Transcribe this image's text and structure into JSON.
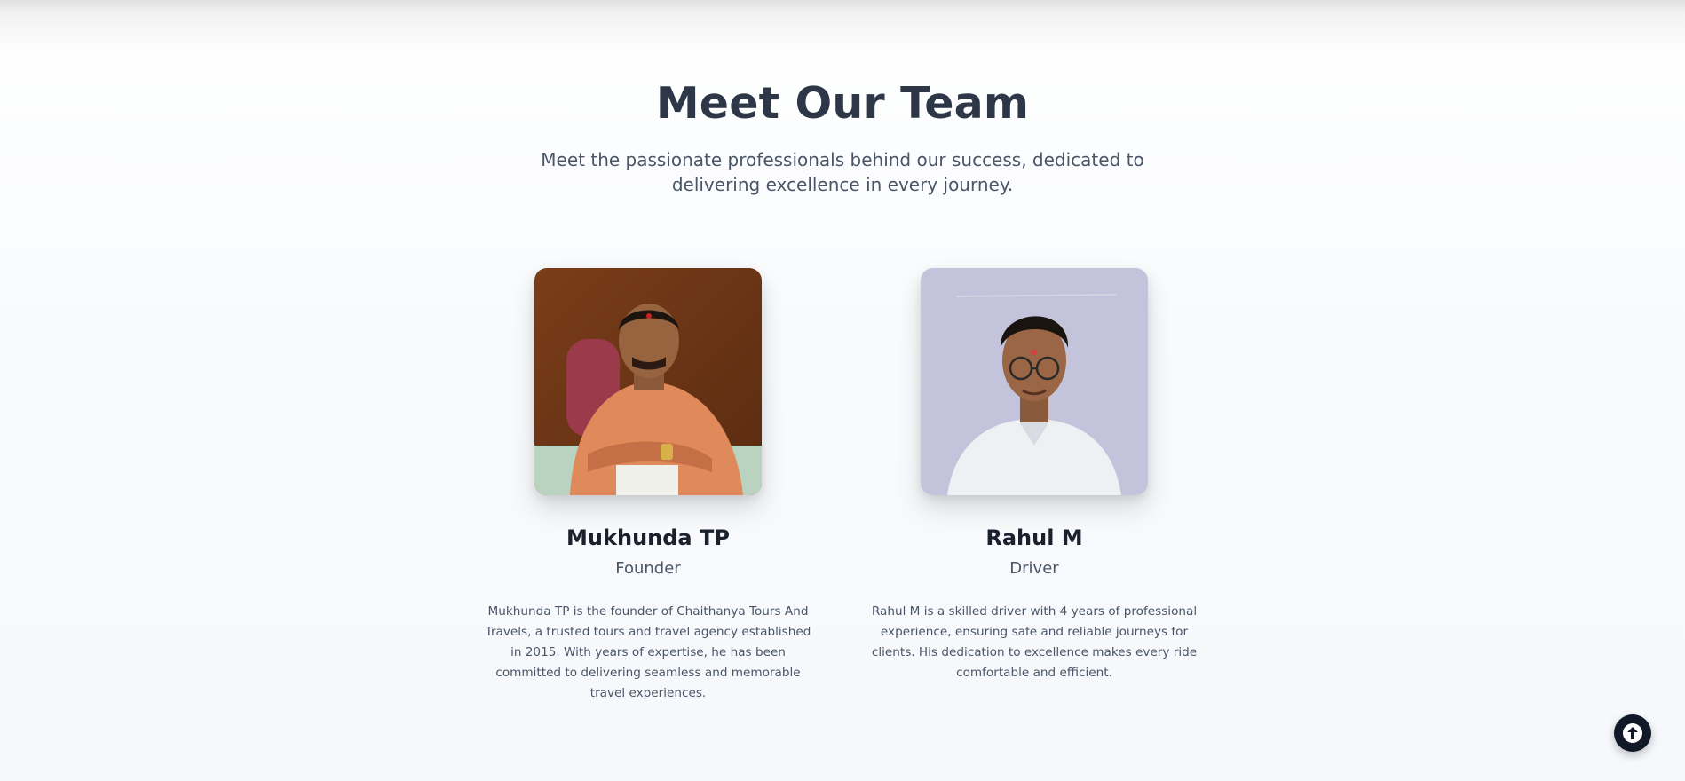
{
  "section": {
    "title": "Meet Our Team",
    "subtitle": "Meet the passionate professionals behind our success, dedicated to delivering excellence in every journey."
  },
  "team": [
    {
      "name": "Mukhunda TP",
      "role": "Founder",
      "bio": "Mukhunda TP is the founder of Chaithanya Tours And Travels, a trusted tours and travel agency established in 2015. With years of expertise, he has been committed to delivering seamless and memorable travel experiences."
    },
    {
      "name": "Rahul M",
      "role": "Driver",
      "bio": "Rahul M is a skilled driver with 4 years of professional experience, ensuring safe and reliable journeys for clients. His dedication to excellence makes every ride comfortable and efficient."
    }
  ],
  "icons": {
    "scroll_top": "arrow-up-circle-icon"
  },
  "colors": {
    "heading": "#2d3748",
    "text": "#4a5568",
    "button_bg": "#111827"
  }
}
